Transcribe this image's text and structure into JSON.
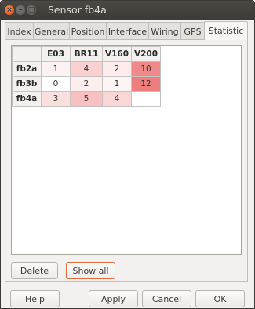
{
  "window": {
    "title": "Sensor fb4a"
  },
  "tabs": [
    {
      "label": "Index"
    },
    {
      "label": "General"
    },
    {
      "label": "Position"
    },
    {
      "label": "Interface"
    },
    {
      "label": "Wiring"
    },
    {
      "label": "GPS"
    },
    {
      "label": "Statistic",
      "active": true
    }
  ],
  "statistic": {
    "columns": [
      "E03",
      "BR11",
      "V160",
      "V200"
    ],
    "rows": [
      {
        "label": "fb2a",
        "cells": [
          "1",
          "4",
          "2",
          "10"
        ]
      },
      {
        "label": "fb3b",
        "cells": [
          "0",
          "2",
          "1",
          "12"
        ]
      },
      {
        "label": "fb4a",
        "cells": [
          "3",
          "5",
          "4",
          ""
        ]
      }
    ],
    "cell_colors": [
      [
        "#fdf2f2",
        "#fbd0d0",
        "#fdecec",
        "#f08a8a"
      ],
      [
        "#ffffff",
        "#fdeeee",
        "#fdf5f5",
        "#ee7d7d"
      ],
      [
        "#fbdede",
        "#f8c0c0",
        "#fbd6d6",
        "#ffffff"
      ]
    ]
  },
  "panel_buttons": {
    "delete": "Delete",
    "show_all": "Show all"
  },
  "dialog_buttons": {
    "help": "Help",
    "apply": "Apply",
    "cancel": "Cancel",
    "ok": "OK"
  }
}
